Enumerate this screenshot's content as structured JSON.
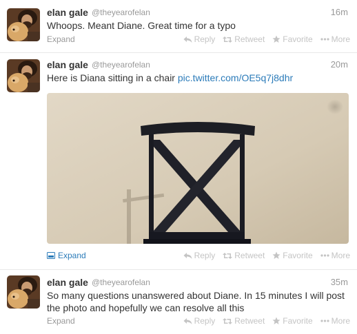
{
  "tweets": [
    {
      "name": "elan gale",
      "handle": "@theyearofelan",
      "time": "16m",
      "text": "Whoops. Meant Diane. Great time for a typo",
      "expand": "Expand"
    },
    {
      "name": "elan gale",
      "handle": "@theyearofelan",
      "time": "20m",
      "text": "Here is Diana sitting in a chair",
      "link": "pic.twitter.com/OE5q7j8dhr",
      "expand": "Expand"
    },
    {
      "name": "elan gale",
      "handle": "@theyearofelan",
      "time": "35m",
      "text": "So many questions unanswered about Diane. In 15 minutes I will post the photo and hopefully we can resolve all this",
      "expand": "Expand"
    }
  ],
  "actions": {
    "reply": "Reply",
    "retweet": "Retweet",
    "favorite": "Favorite",
    "more": "More"
  },
  "colors": {
    "link": "#2b7bb9",
    "muted": "#999999",
    "action": "#c4c4c4"
  }
}
